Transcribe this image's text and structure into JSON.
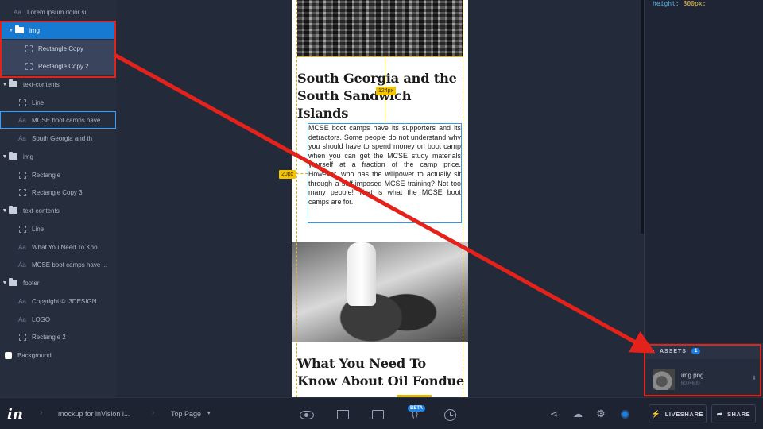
{
  "layers": [
    {
      "label": "Lorem ipsum dolor si",
      "icon": "text-icon",
      "depth": 1
    },
    {
      "label": "img",
      "icon": "folder-icon",
      "depth": 1,
      "expanded": true,
      "selected": true
    },
    {
      "label": "Rectangle Copy",
      "icon": "rectangle-icon",
      "depth": 2
    },
    {
      "label": "Rectangle Copy 2",
      "icon": "rectangle-icon",
      "depth": 2
    },
    {
      "label": "text-contents",
      "icon": "folder-icon",
      "depth": 0,
      "expanded": true
    },
    {
      "label": "Line",
      "icon": "rectangle-icon",
      "depth": 1
    },
    {
      "label": "MCSE boot camps have",
      "icon": "text-icon",
      "depth": 1,
      "hovered": true
    },
    {
      "label": "South Georgia and th",
      "icon": "text-icon",
      "depth": 1
    },
    {
      "label": "img",
      "icon": "folder-icon",
      "depth": 0,
      "expanded": true
    },
    {
      "label": "Rectangle",
      "icon": "rectangle-icon",
      "depth": 1
    },
    {
      "label": "Rectangle Copy 3",
      "icon": "rectangle-icon",
      "depth": 1
    },
    {
      "label": "text-contents",
      "icon": "folder-icon",
      "depth": 0,
      "expanded": true
    },
    {
      "label": "Line",
      "icon": "rectangle-icon",
      "depth": 1
    },
    {
      "label": "What You Need To Kno",
      "icon": "text-icon",
      "depth": 1
    },
    {
      "label": "MCSE boot camps have ...",
      "icon": "text-icon",
      "depth": 1
    },
    {
      "label": "footer",
      "icon": "folder-icon",
      "depth": 0,
      "expanded": true
    },
    {
      "label": "Copyright © i3DESIGN",
      "icon": "text-icon",
      "depth": 1
    },
    {
      "label": "LOGO",
      "icon": "text-icon",
      "depth": 1
    },
    {
      "label": "Rectangle 2",
      "icon": "rectangle-icon",
      "depth": 1
    },
    {
      "label": "Background",
      "icon": "checkbox-icon",
      "depth": 0
    }
  ],
  "canvas": {
    "heading1": "South Georgia and the South Sandwich Islands",
    "paragraph": "MCSE boot camps have its supporters and its detractors. Some people do not understand why you should have to spend money on boot camp when you can get the MCSE study materials yourself at a fraction of the camp price. However, who has the willpower to actually sit through a self-imposed MCSE training? Not too many people! That is what the MCSE boot camps are for.",
    "heading2": "What You Need To Know About Oil Fondue",
    "measure_vertical": "124px",
    "measure_horizontal": "20px"
  },
  "code": {
    "property": "height:",
    "value": "300px;"
  },
  "assets": {
    "title": "ASSETS",
    "count": "1",
    "file_name": "img.png",
    "file_dims": "600×600"
  },
  "toolbar": {
    "logo": "in",
    "project": "mockup for inVision i...",
    "page": "Top Page",
    "beta": "BETA",
    "liveshare": "LIVESHARE",
    "share": "SHARE"
  },
  "colors": {
    "accent": "#1679d2",
    "annotation": "#e3231b",
    "guide": "#e8b800"
  }
}
